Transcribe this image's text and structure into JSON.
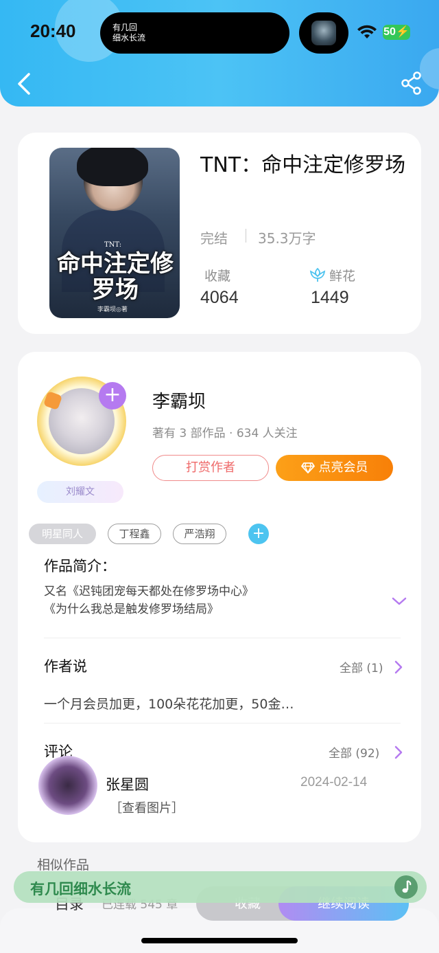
{
  "status_bar": {
    "time": "20:40",
    "island_text": "有几回\n细水长流",
    "battery": "50"
  },
  "book": {
    "cover_tag": "TNT:",
    "cover_title": "命中注定修罗场",
    "cover_author": "李霸坝◎著",
    "title": "TNT：命中注定修罗场",
    "status": "完结",
    "word_count": "35.3万字",
    "stats": {
      "collect_label": "收藏",
      "collect_value": "4064",
      "flower_label": "鲜花",
      "flower_value": "1449"
    }
  },
  "author": {
    "name": "李霸坝",
    "meta": "著有 3 部作品 · 634 人关注",
    "avatar_tag": "刘耀文",
    "reward_label": "打赏作者",
    "vip_label": "点亮会员",
    "tags": [
      "明星同人",
      "丁程鑫",
      "严浩翔"
    ]
  },
  "intro": {
    "title": "作品简介：",
    "line1": "又名《迟钝团宠每天都处在修罗场中心》",
    "line2": "《为什么我总是触发修罗场结局》"
  },
  "author_say": {
    "title": "作者说",
    "more": "全部 (1)",
    "text": "一个月会员加更，100朵花花加更，50金…"
  },
  "comments": {
    "title": "评论",
    "more": "全部 (92)",
    "user": "张星圆",
    "date": "2024-02-14",
    "text": "［查看图片］"
  },
  "similar": {
    "title": "相似作品"
  },
  "bottom": {
    "catalog": "目录",
    "progress": "已连载 545 章",
    "collect": "收藏",
    "read": "继续阅读"
  },
  "music": {
    "text": "有几回细水长流"
  },
  "colors": {
    "header": "#3db9f3",
    "accent_purple": "#b57af0",
    "vip_orange": "#fa8e10",
    "reward_red": "#ef6a6a"
  }
}
